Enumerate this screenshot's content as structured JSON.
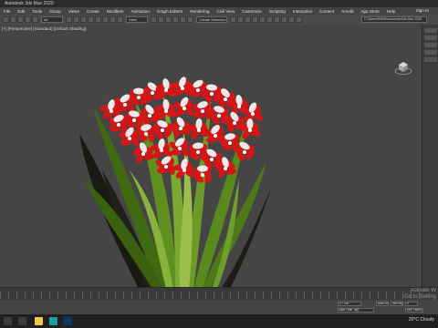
{
  "window": {
    "title": "Autodesk 3ds Max 2020"
  },
  "menu": {
    "items": [
      "File",
      "Edit",
      "Tools",
      "Group",
      "Views",
      "Create",
      "Modifiers",
      "Animation",
      "Graph Editors",
      "Rendering",
      "Civil View",
      "Customize",
      "Scripting",
      "Interactive",
      "Content",
      "Arnold",
      "App Store",
      "Help"
    ],
    "sign_in": "Sign In"
  },
  "toolbar": {
    "filter": "All",
    "view": "View",
    "selection_set": "Create Selection Se",
    "project_path": "C:\\Users\\RM\\Documents\\3ds Max 2020"
  },
  "viewport": {
    "label": "[+] [Perspective] [Standard] [Default Shading]"
  },
  "status": {
    "frame": "0 / 100",
    "add_time_tag": "Add Time Tag",
    "auto_key": "Auto Key",
    "set_key": "Set Key",
    "key_filters": "Key Filters...",
    "frame_field": "0"
  },
  "watermark": {
    "line1": "Activate W",
    "line2": "Go to Setting"
  },
  "taskbar": {
    "weather_temp": "20°C",
    "weather_text": "Cloudy",
    "search_icon": "search-icon",
    "apps": [
      "explorer-icon",
      "folder-icon",
      "3dsmax-icon",
      "photoshop-icon"
    ]
  },
  "colors": {
    "petal": "#d41616",
    "leaf": "#5f8f1f",
    "viewport_bg": "#454545"
  }
}
